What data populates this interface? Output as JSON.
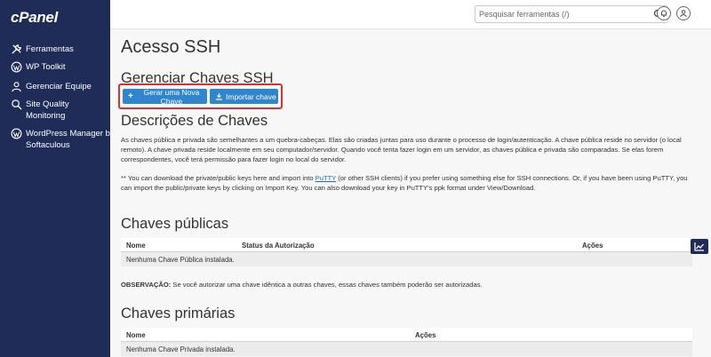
{
  "brand": {
    "logo": "cPanel"
  },
  "sidebar": {
    "items": [
      {
        "label": "Ferramentas",
        "icon": "tools-icon"
      },
      {
        "label": "WP Toolkit",
        "icon": "wordpress-icon"
      },
      {
        "label": "Gerenciar Equipe",
        "icon": "team-icon"
      },
      {
        "label": "Site Quality Monitoring",
        "icon": "site-quality-icon"
      },
      {
        "label": "WordPress Manager by Softaculous",
        "icon": "wordpress-icon"
      }
    ]
  },
  "topbar": {
    "search_placeholder": "Pesquisar ferramentas (/)"
  },
  "page": {
    "title": "Acesso SSH"
  },
  "manage": {
    "title": "Gerenciar Chaves SSH",
    "new_key_label": "Gerar uma Nova Chave",
    "import_key_label": "Importar chave"
  },
  "descriptions": {
    "title": "Descrições de Chaves",
    "para1": "As chaves pública e privada são semelhantes a um quebra-cabeças. Elas são criadas juntas para uso durante o processo de login/autenticação. A chave pública reside no servidor (o local remoto). A chave privada reside localmente em seu computador/servidor. Quando você tenta fazer login em um servidor, as chaves pública e privada são comparadas. Se elas forem correspondentes, você terá permissão para fazer login no local do servidor.",
    "para2_before": "** You can download the private/public keys here and import into ",
    "para2_link": "PuTTY",
    "para2_after": " (or other SSH clients) if you prefer using something else for SSH connections. Or, if you have been using PuTTY, you can import the public/private keys by clicking on Import Key. You can also download your key in PuTTY's ppk format under View/Download."
  },
  "public_keys": {
    "title": "Chaves públicas",
    "columns": [
      "Nome",
      "Status da Autorização",
      "Ações"
    ],
    "empty": "Nenhuma Chave Pública instalada.",
    "note_label": "OBSERVAÇÃO:",
    "note_text": " Se você autorizar uma chave idêntica a outras chaves, essas chaves também poderão ser autorizadas."
  },
  "private_keys": {
    "title": "Chaves primárias",
    "columns": [
      "Nome",
      "Ações"
    ],
    "empty": "Nenhuma Chave Privada instalada."
  }
}
